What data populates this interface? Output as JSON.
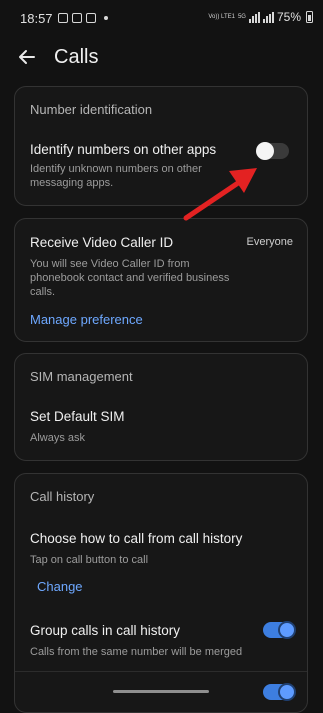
{
  "status": {
    "time": "18:57",
    "signal_label_1": "Vo)) LTE1",
    "signal_label_2": "5G",
    "battery": "75%"
  },
  "header": {
    "title": "Calls"
  },
  "number_identification": {
    "section_title": "Number identification",
    "toggle_title": "Identify numbers on other apps",
    "toggle_subtitle": "Identify unknown numbers on other messaging apps.",
    "toggle_on": false
  },
  "video_caller": {
    "title": "Receive Video Caller ID",
    "value": "Everyone",
    "subtitle": "You will see Video Caller ID from phonebook contact and verified business calls.",
    "link": "Manage preference"
  },
  "sim": {
    "section_title": "SIM management",
    "title": "Set Default SIM",
    "subtitle": "Always ask"
  },
  "call_history": {
    "section_title": "Call history",
    "choose_title": "Choose how to call from call history",
    "choose_subtitle": "Tap on call button to call",
    "change_link": "Change",
    "group_title": "Group calls in call history",
    "group_subtitle": "Calls from the same number will be merged",
    "group_on": true
  },
  "colors": {
    "accent": "#6ea8ff",
    "toggle_on": "#3d7ee0",
    "arrow": "#e32222"
  }
}
